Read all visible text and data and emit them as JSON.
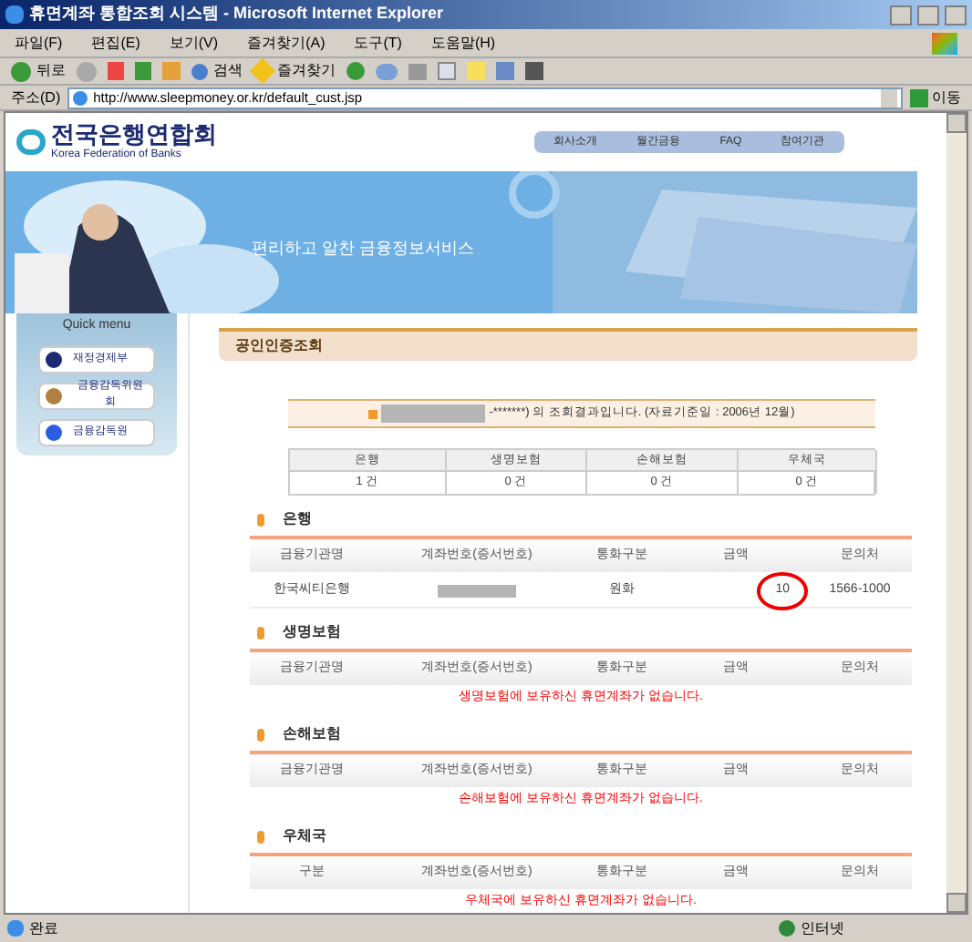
{
  "window": {
    "title": "휴면계좌 통합조회 시스템 - Microsoft Internet Explorer"
  },
  "menu": [
    "파일(F)",
    "편집(E)",
    "보기(V)",
    "즐겨찾기(A)",
    "도구(T)",
    "도움말(H)"
  ],
  "toolbar": {
    "back": "뒤로",
    "search": "검색",
    "favorites": "즐겨찾기"
  },
  "address": {
    "label": "주소(D)",
    "value": "http://www.sleepmoney.or.kr/default_cust.jsp",
    "go": "이동"
  },
  "site": {
    "logo": "전국은행연합회",
    "logo_en": "Korea Federation of Banks",
    "nav": [
      "회사소개",
      "월간금융",
      "FAQ",
      "참여기관"
    ],
    "slogan": "편리하고 알찬 금융정보서비스"
  },
  "quick_menu": {
    "title": "Quick menu",
    "items": [
      "재정경제부",
      "금융감독위원회",
      "금융감독원"
    ]
  },
  "page_title": "공인인증조회",
  "result_notice": "-*******) 의 조회결과입니다. (자료기준일 : 2006년 12월)",
  "summary": {
    "columns": [
      "은행",
      "생명보험",
      "손해보험",
      "우체국"
    ],
    "values": [
      "1 건",
      "0 건",
      "0 건",
      "0 건"
    ]
  },
  "sections": [
    {
      "title": "은행",
      "columns": [
        "금융기관명",
        "계좌번호(증서번호)",
        "통화구분",
        "금액",
        "문의처"
      ],
      "rows": [
        {
          "institution": "한국씨티은행",
          "currency": "원화",
          "amount": "10",
          "contact": "1566-1000",
          "circled": true
        }
      ]
    },
    {
      "title": "생명보험",
      "columns": [
        "금융기관명",
        "계좌번호(증서번호)",
        "통화구분",
        "금액",
        "문의처"
      ],
      "empty": "생명보험에 보유하신 휴면계좌가 없습니다."
    },
    {
      "title": "손해보험",
      "columns": [
        "금융기관명",
        "계좌번호(증서번호)",
        "통화구분",
        "금액",
        "문의처"
      ],
      "empty": "손해보험에 보유하신 휴면계좌가 없습니다."
    },
    {
      "title": "우체국",
      "columns": [
        "구분",
        "계좌번호(증서번호)",
        "통화구분",
        "금액",
        "문의처"
      ],
      "empty": "우체국에 보유하신 휴면계좌가 없습니다."
    }
  ],
  "status_bar": {
    "text": "완료",
    "zone": "인터넷"
  }
}
